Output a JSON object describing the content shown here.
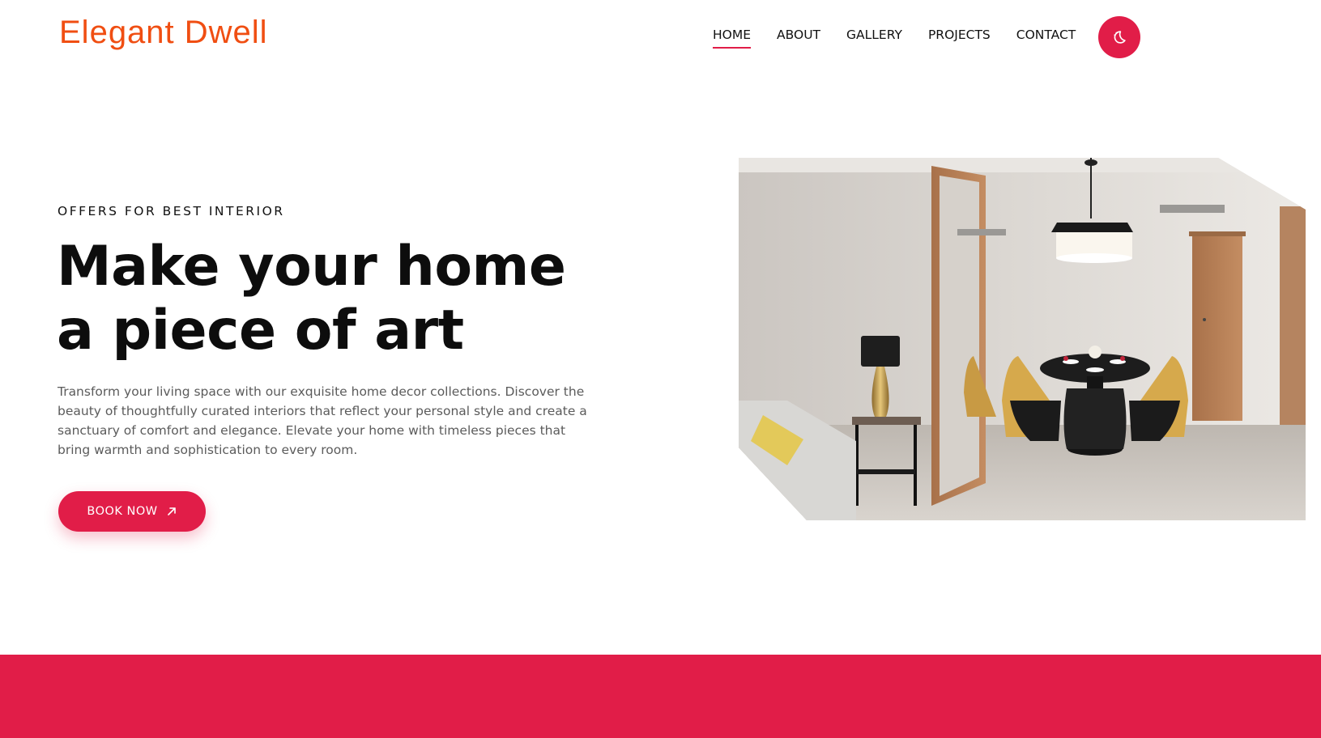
{
  "brand": {
    "name": "Elegant Dwell",
    "color": "#f04e12"
  },
  "nav": {
    "items": [
      {
        "label": "HOME",
        "active": true
      },
      {
        "label": "ABOUT",
        "active": false
      },
      {
        "label": "GALLERY",
        "active": false
      },
      {
        "label": "PROJECTS",
        "active": false
      },
      {
        "label": "CONTACT",
        "active": false
      }
    ],
    "theme_toggle_icon": "moon-icon"
  },
  "hero": {
    "eyebrow": "OFFERS FOR BEST INTERIOR",
    "headline": "Make your home a piece of art",
    "description": "Transform your living space with our exquisite home decor collections. Discover the beauty of thoughtfully curated interiors that reflect your personal style and create a sanctuary of comfort and elegance. Elevate your home with timeless pieces that bring warmth and sophistication to every room.",
    "cta_label": "BOOK NOW",
    "cta_icon": "arrow-up-right-icon",
    "image": "dining-room-photo"
  },
  "colors": {
    "accent": "#e11d48",
    "text": "#111111",
    "muted": "#5b5b5b"
  }
}
